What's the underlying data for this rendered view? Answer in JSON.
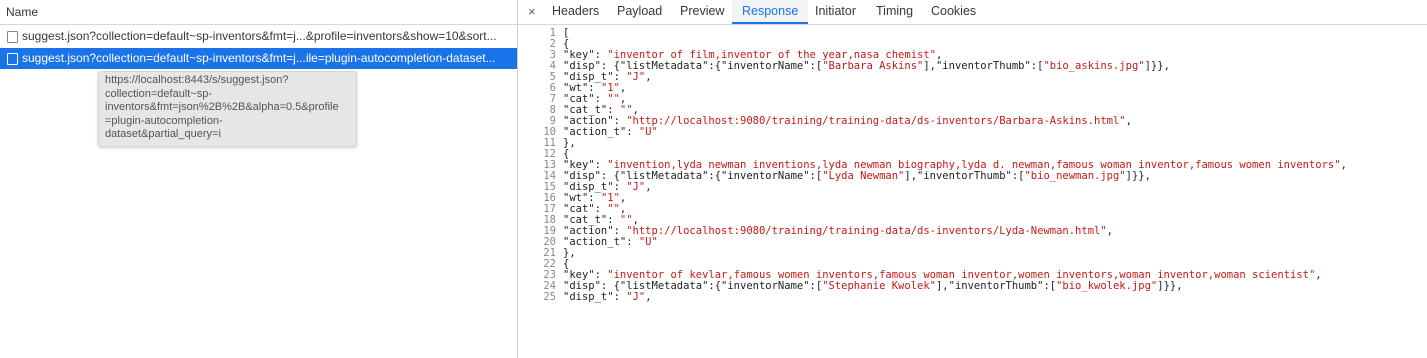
{
  "network": {
    "name_header": "Name",
    "requests": [
      {
        "label": "suggest.json?collection=default~sp-inventors&fmt=j...&profile=inventors&show=10&sort..."
      },
      {
        "label": "suggest.json?collection=default~sp-inventors&fmt=j...ile=plugin-autocompletion-dataset..."
      }
    ],
    "tooltip_lines": [
      "https://localhost:8443/s/suggest.json?",
      "collection=default~sp-",
      "inventors&fmt=json%2B%2B&alpha=0.5&profile",
      "=plugin-autocompletion-",
      "dataset&partial_query=i"
    ]
  },
  "detail": {
    "close_glyph": "×",
    "tabs": [
      "Headers",
      "Payload",
      "Preview",
      "Response",
      "Initiator",
      "Timing",
      "Cookies"
    ],
    "active_tab": "Response"
  },
  "response_lines": [
    {
      "n": "1",
      "parts": [
        [
          "[",
          ""
        ]
      ]
    },
    {
      "n": "2",
      "parts": [
        [
          "{",
          ""
        ]
      ]
    },
    {
      "n": "3",
      "parts": [
        [
          "\"key\": ",
          ""
        ],
        [
          "\"inventor of film,inventor of the year,nasa chemist\"",
          "s"
        ],
        [
          ",",
          ""
        ]
      ]
    },
    {
      "n": "4",
      "parts": [
        [
          "\"disp\": {\"listMetadata\":{\"inventorName\":[",
          ""
        ],
        [
          "\"Barbara Askins\"",
          "s"
        ],
        [
          "],\"inventorThumb\":[",
          ""
        ],
        [
          "\"bio_askins.jpg\"",
          "s"
        ],
        [
          "]}},",
          ""
        ]
      ]
    },
    {
      "n": "5",
      "parts": [
        [
          "\"disp_t\": ",
          ""
        ],
        [
          "\"J\"",
          "s"
        ],
        [
          ",",
          ""
        ]
      ]
    },
    {
      "n": "6",
      "parts": [
        [
          "\"wt\": ",
          ""
        ],
        [
          "\"1\"",
          "s"
        ],
        [
          ",",
          ""
        ]
      ]
    },
    {
      "n": "7",
      "parts": [
        [
          "\"cat\": ",
          ""
        ],
        [
          "\"\"",
          "s"
        ],
        [
          ",",
          ""
        ]
      ]
    },
    {
      "n": "8",
      "parts": [
        [
          "\"cat_t\": ",
          ""
        ],
        [
          "\"\"",
          "s"
        ],
        [
          ",",
          ""
        ]
      ]
    },
    {
      "n": "9",
      "parts": [
        [
          "\"action\": ",
          ""
        ],
        [
          "\"http://localhost:9080/training/training-data/ds-inventors/Barbara-Askins.html\"",
          "s"
        ],
        [
          ",",
          ""
        ]
      ]
    },
    {
      "n": "10",
      "parts": [
        [
          "\"action_t\": ",
          ""
        ],
        [
          "\"U\"",
          "s"
        ]
      ]
    },
    {
      "n": "11",
      "parts": [
        [
          "},",
          ""
        ]
      ]
    },
    {
      "n": "12",
      "parts": [
        [
          "{",
          ""
        ]
      ]
    },
    {
      "n": "13",
      "parts": [
        [
          "\"key\": ",
          ""
        ],
        [
          "\"invention,lyda newman inventions,lyda newman biography,lyda d. newman,famous woman inventor,famous women inventors\"",
          "s"
        ],
        [
          ",",
          ""
        ]
      ]
    },
    {
      "n": "14",
      "parts": [
        [
          "\"disp\": {\"listMetadata\":{\"inventorName\":[",
          ""
        ],
        [
          "\"Lyda Newman\"",
          "s"
        ],
        [
          "],\"inventorThumb\":[",
          ""
        ],
        [
          "\"bio_newman.jpg\"",
          "s"
        ],
        [
          "]}},",
          ""
        ]
      ]
    },
    {
      "n": "15",
      "parts": [
        [
          "\"disp_t\": ",
          ""
        ],
        [
          "\"J\"",
          "s"
        ],
        [
          ",",
          ""
        ]
      ]
    },
    {
      "n": "16",
      "parts": [
        [
          "\"wt\": ",
          ""
        ],
        [
          "\"1\"",
          "s"
        ],
        [
          ",",
          ""
        ]
      ]
    },
    {
      "n": "17",
      "parts": [
        [
          "\"cat\": ",
          ""
        ],
        [
          "\"\"",
          "s"
        ],
        [
          ",",
          ""
        ]
      ]
    },
    {
      "n": "18",
      "parts": [
        [
          "\"cat_t\": ",
          ""
        ],
        [
          "\"\"",
          "s"
        ],
        [
          ",",
          ""
        ]
      ]
    },
    {
      "n": "19",
      "parts": [
        [
          "\"action\": ",
          ""
        ],
        [
          "\"http://localhost:9080/training/training-data/ds-inventors/Lyda-Newman.html\"",
          "s"
        ],
        [
          ",",
          ""
        ]
      ]
    },
    {
      "n": "20",
      "parts": [
        [
          "\"action_t\": ",
          ""
        ],
        [
          "\"U\"",
          "s"
        ]
      ]
    },
    {
      "n": "21",
      "parts": [
        [
          "},",
          ""
        ]
      ]
    },
    {
      "n": "22",
      "parts": [
        [
          "{",
          ""
        ]
      ]
    },
    {
      "n": "23",
      "parts": [
        [
          "\"key\": ",
          ""
        ],
        [
          "\"inventor of kevlar,famous women inventors,famous woman inventor,women inventors,woman inventor,woman scientist\"",
          "s"
        ],
        [
          ",",
          ""
        ]
      ]
    },
    {
      "n": "24",
      "parts": [
        [
          "\"disp\": {\"listMetadata\":{\"inventorName\":[",
          ""
        ],
        [
          "\"Stephanie Kwolek\"",
          "s"
        ],
        [
          "],\"inventorThumb\":[",
          ""
        ],
        [
          "\"bio_kwolek.jpg\"",
          "s"
        ],
        [
          "]}},",
          ""
        ]
      ]
    },
    {
      "n": "25",
      "parts": [
        [
          "\"disp_t\": ",
          ""
        ],
        [
          "\"J\"",
          "s"
        ],
        [
          ",",
          ""
        ]
      ]
    }
  ],
  "colors": {
    "accent": "#1a73e8",
    "string": "#c41a16",
    "selected_row": "#1a73e8"
  }
}
